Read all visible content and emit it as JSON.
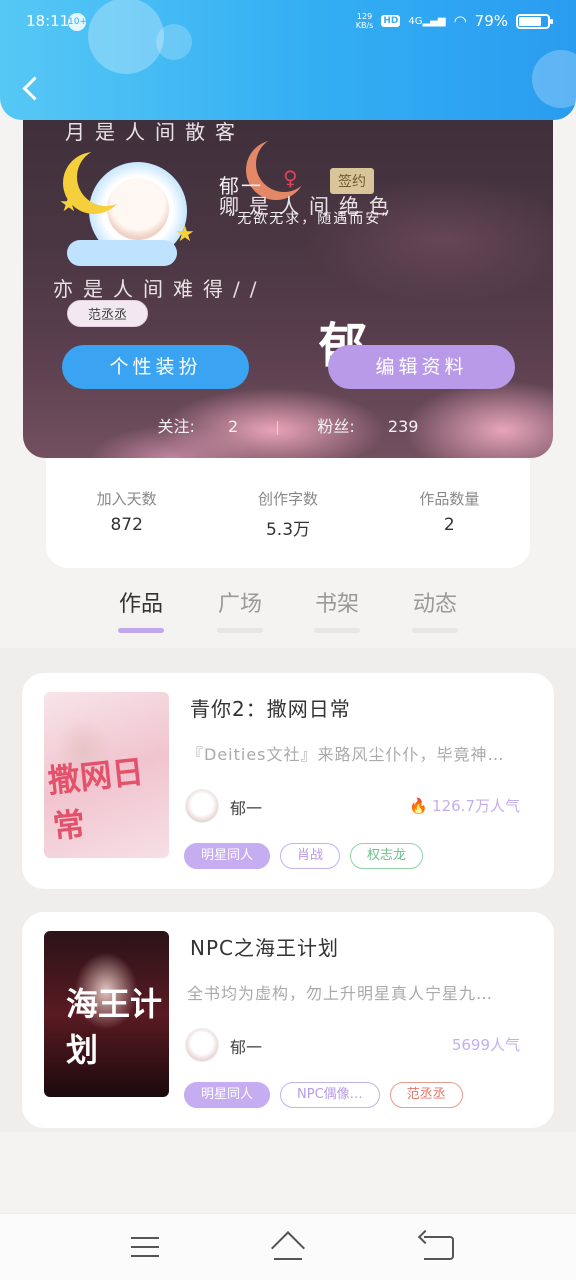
{
  "status_bar": {
    "time": "18:11",
    "notification_count": "10+",
    "net_speed_top": "129",
    "net_speed_bottom": "KB/s",
    "hd_label": "HD",
    "network": "4G",
    "battery": "79%"
  },
  "profile": {
    "poem_line1": "月是人间散客",
    "poem_line2": "卿是人间绝色",
    "poem_line3": "亦是人间难得//",
    "username": "郁一",
    "gender_symbol": "♀",
    "contract_tag": "签约",
    "motto": "“无欲无求，随遇而安”",
    "name_tag": "范丞丞",
    "big_glyph": "郁",
    "dress_button": "个性装扮",
    "edit_button": "编辑资料",
    "follow_label": "关注:",
    "follow_count": "2",
    "fans_label": "粉丝:",
    "fans_count": "239"
  },
  "stats": [
    {
      "label": "加入天数",
      "value": "872"
    },
    {
      "label": "创作字数",
      "value": "5.3万"
    },
    {
      "label": "作品数量",
      "value": "2"
    }
  ],
  "tabs": [
    {
      "label": "作品",
      "active": true
    },
    {
      "label": "广场",
      "active": false
    },
    {
      "label": "书架",
      "active": false
    },
    {
      "label": "动态",
      "active": false
    }
  ],
  "books": [
    {
      "title": "青你2：撒网日常",
      "cover_text": "撒网日常",
      "description": "『Deities文社』来路风尘仆仆，毕竟神…",
      "author": "郁一",
      "popularity": "126.7万人气",
      "tags": [
        "明星同人",
        "肖战",
        "权志龙"
      ]
    },
    {
      "title": "NPC之海王计划",
      "cover_text": "海王计划",
      "description": "全书均为虚构，勿上升明星真人宁星九…",
      "author": "郁一",
      "popularity": "5699人气",
      "tags": [
        "明星同人",
        "NPC偶像…",
        "范丞丞"
      ]
    }
  ],
  "icons": {
    "back": "back-arrow-icon",
    "flame": "flame-icon",
    "nav_menu": "menu-icon",
    "nav_home": "home-icon",
    "nav_back": "return-icon"
  },
  "colors": {
    "header_blue": "#33aef3",
    "accent_purple": "#c1a7ec",
    "button_blue": "#3aa4f2",
    "button_purple": "#b99ae8"
  }
}
